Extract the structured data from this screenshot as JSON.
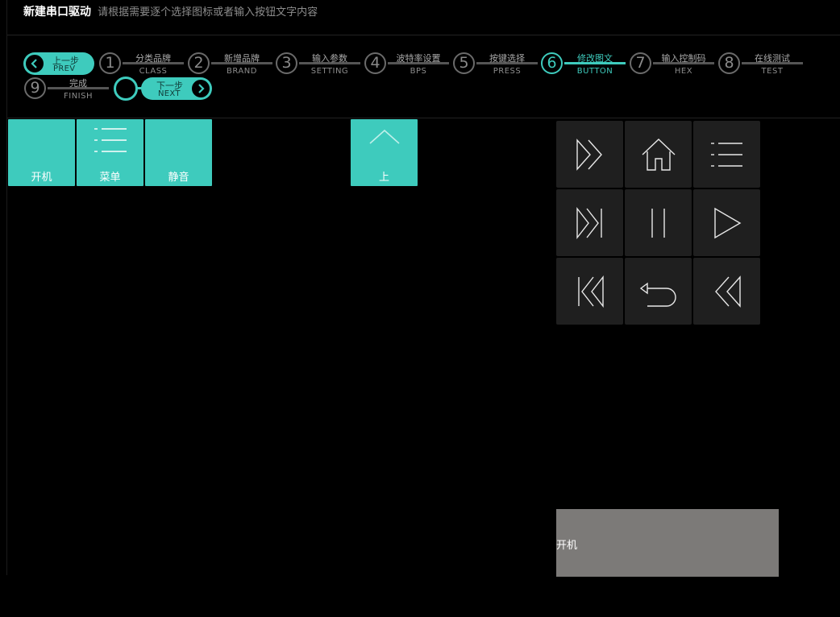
{
  "header": {
    "title": "新建串口驱动",
    "subtitle": "请根据需要逐个选择图标或者输入按钮文字内容"
  },
  "nav": {
    "prev": {
      "cn": "上一步",
      "en": "PREV"
    },
    "next": {
      "cn": "下一步",
      "en": "NEXT"
    }
  },
  "steps": [
    {
      "num": "1",
      "cn": "分类品牌",
      "en": "CLASS"
    },
    {
      "num": "2",
      "cn": "新增品牌",
      "en": "BRAND"
    },
    {
      "num": "3",
      "cn": "输入参数",
      "en": "SETTING"
    },
    {
      "num": "4",
      "cn": "波特率设置",
      "en": "BPS"
    },
    {
      "num": "5",
      "cn": "按键选择",
      "en": "PRESS"
    },
    {
      "num": "6",
      "cn": "修改图文",
      "en": "BUTTON"
    },
    {
      "num": "7",
      "cn": "输入控制码",
      "en": "HEX"
    },
    {
      "num": "8",
      "cn": "在线测试",
      "en": "TEST"
    },
    {
      "num": "9",
      "cn": "完成",
      "en": "FINISH"
    }
  ],
  "active_step": "6",
  "buttons": [
    {
      "label": "开机",
      "icon": "none"
    },
    {
      "label": "菜单",
      "icon": "menu-list-icon"
    },
    {
      "label": "静音",
      "icon": "none"
    },
    {
      "label": "上",
      "icon": "chevron-up-icon"
    }
  ],
  "icon_grid": [
    "fast-forward-icon",
    "home-icon",
    "menu-list-icon",
    "skip-next-icon",
    "pause-icon",
    "play-icon",
    "skip-previous-icon",
    "return-icon",
    "rewind-icon"
  ],
  "preview": {
    "label": "开机"
  },
  "colors": {
    "accent": "#3ecbbd",
    "cell": "#1f1f1f",
    "preview": "#7c7a78"
  }
}
